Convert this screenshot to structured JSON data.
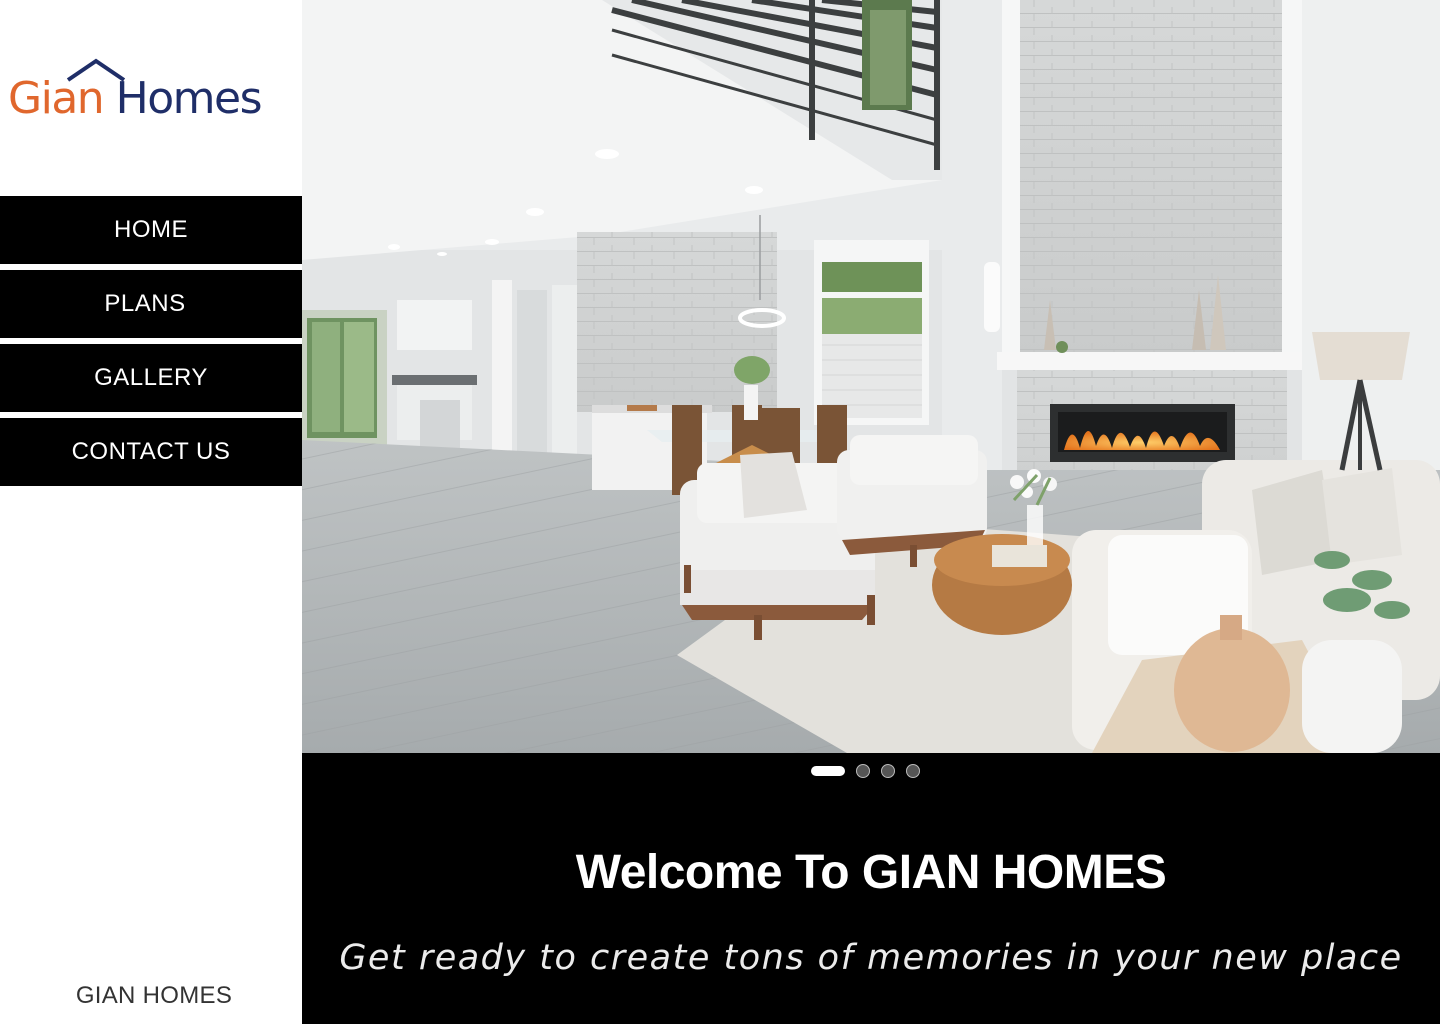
{
  "brand": {
    "logo_word1": "Gian",
    "logo_word2": "Homes",
    "footer": "GIAN HOMES"
  },
  "colors": {
    "logo_orange": "#e0672d",
    "logo_navy": "#1f2e68",
    "nav_background": "#000000",
    "nav_text": "#ffffff"
  },
  "nav": {
    "items": [
      {
        "label": "HOME"
      },
      {
        "label": "PLANS"
      },
      {
        "label": "GALLERY"
      },
      {
        "label": "CONTACT US"
      }
    ]
  },
  "hero": {
    "image_subject": "living-room-interior",
    "slide_count": 4,
    "active_slide": 1
  },
  "caption": {
    "title": "Welcome To GIAN HOMES",
    "subtitle": "Get ready to create tons of memories in your new place"
  },
  "icons": {
    "logo_roof": "house-roof-icon"
  }
}
